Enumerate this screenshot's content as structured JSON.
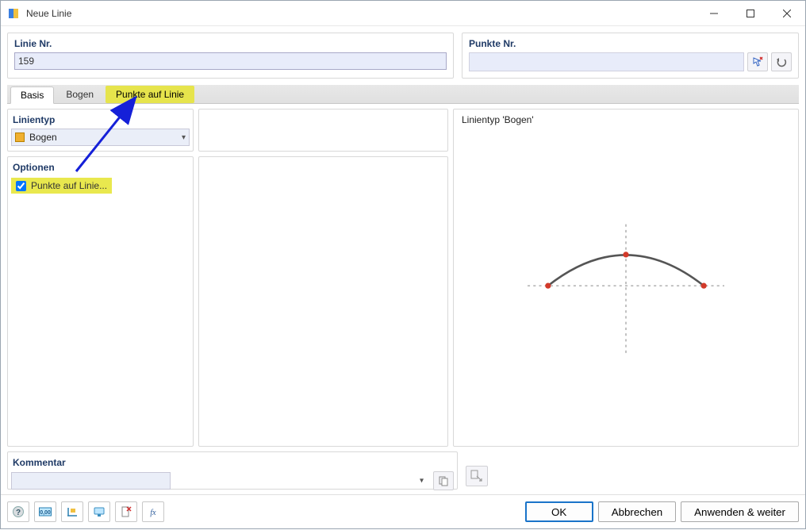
{
  "window": {
    "title": "Neue Linie"
  },
  "linieNr": {
    "label": "Linie Nr.",
    "value": "159"
  },
  "punkteNr": {
    "label": "Punkte Nr.",
    "value": ""
  },
  "tabs": {
    "basis": "Basis",
    "bogen": "Bogen",
    "punkte": "Punkte auf Linie"
  },
  "left": {
    "linientyp_label": "Linientyp",
    "linientyp_value": "Bogen",
    "optionen_label": "Optionen",
    "option_punkte": "Punkte auf Linie..."
  },
  "preview": {
    "title": "Linientyp 'Bogen'"
  },
  "kommentar": {
    "label": "Kommentar",
    "value": ""
  },
  "footer": {
    "ok": "OK",
    "cancel": "Abbrechen",
    "apply": "Anwenden & weiter"
  }
}
